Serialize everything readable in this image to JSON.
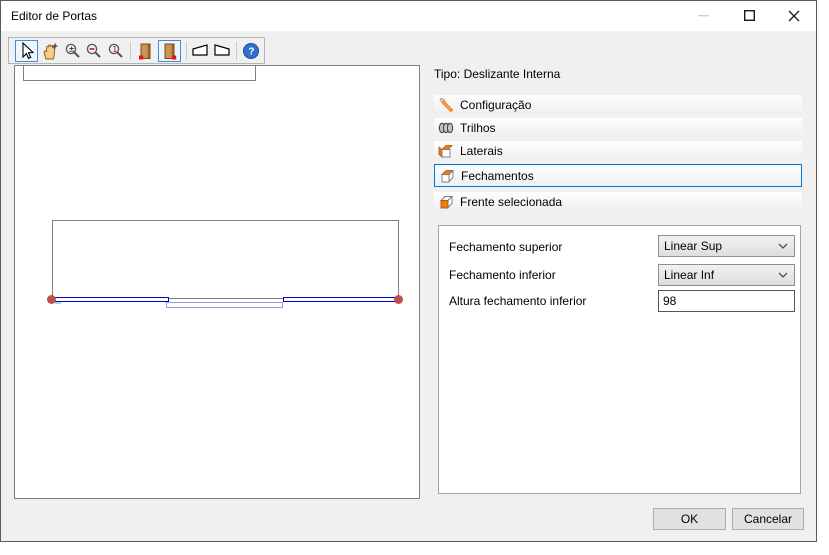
{
  "window": {
    "title": "Editor de Portas",
    "controls": [
      "minimize-icon",
      "maximize-icon",
      "close-icon"
    ]
  },
  "toolbar": {
    "buttons": [
      {
        "name": "select-tool",
        "icon": "cursor-arrow-icon",
        "selected": true
      },
      {
        "name": "pan-tool",
        "icon": "hand-icon",
        "selected": false
      },
      {
        "name": "zoom-tool",
        "icon": "magnifier-plus-minus-icon",
        "selected": false
      },
      {
        "name": "zoom-out-tool",
        "icon": "magnifier-minus-icon",
        "selected": false
      },
      {
        "name": "zoom-actual-tool",
        "icon": "magnifier-one-icon",
        "selected": false
      },
      {
        "name": "door-open-tool",
        "icon": "door-open-icon",
        "selected": false
      },
      {
        "name": "door-closed-tool",
        "icon": "door-closed-icon",
        "selected": true
      },
      {
        "name": "skew-left-tool",
        "icon": "skew-left-icon",
        "selected": false
      },
      {
        "name": "skew-right-tool",
        "icon": "skew-right-icon",
        "selected": false
      },
      {
        "name": "help-tool",
        "icon": "help-icon",
        "selected": false
      }
    ]
  },
  "right_panel": {
    "type_label": "Tipo: Deslizante Interna",
    "accordion": {
      "items": [
        {
          "label": "Configuração",
          "icon": "wrench-icon",
          "selected": false
        },
        {
          "label": "Trilhos",
          "icon": "rails-coil-icon",
          "selected": false
        },
        {
          "label": "Laterais",
          "icon": "box-side-icon",
          "selected": false
        },
        {
          "label": "Fechamentos",
          "icon": "box-top-icon",
          "selected": true
        },
        {
          "label": "Frente selecionada",
          "icon": "box-front-icon",
          "selected": false
        }
      ]
    },
    "form": {
      "fields": [
        {
          "label": "Fechamento superior",
          "control": "dropdown",
          "value": "Linear Sup"
        },
        {
          "label": "Fechamento inferior",
          "control": "dropdown",
          "value": "Linear Inf"
        },
        {
          "label": "Altura fechamento inferior",
          "control": "input",
          "value": "98"
        }
      ]
    }
  },
  "footer": {
    "ok_label": "OK",
    "cancel_label": "Cancelar"
  },
  "colors": {
    "accent_selection": "#0078d7",
    "tool_selected_border": "#3d8edb",
    "drawing_outline": "#7f7f7f",
    "selected_closure_blue": "#0000cd",
    "inactive_closure_lavender": "#9b9bdb",
    "handle_red": "#c0504d",
    "icon_orange": "#f07b12"
  }
}
